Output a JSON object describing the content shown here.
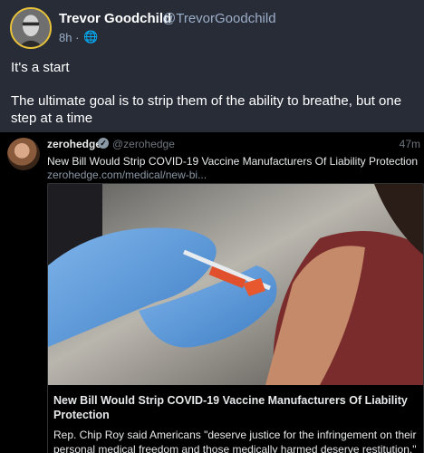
{
  "post": {
    "display_name": "Trevor Goodchild",
    "handle": "@TrevorGoodchild",
    "time": "8h",
    "separator": "·",
    "visibility_icon": "globe-icon",
    "paragraph_1": "It's a start",
    "paragraph_2": "The ultimate goal is to strip them of the ability to breathe, but one step at a time"
  },
  "embedded_tweet": {
    "name": "zerohedge",
    "handle": "@zerohedge",
    "time": "47m",
    "text": "New Bill Would Strip COVID-19 Vaccine Manufacturers Of Liability Protection",
    "link": "zerohedge.com/medical/new-bi...",
    "card": {
      "title": "New Bill Would Strip COVID-19 Vaccine Manufacturers Of Liability Protection",
      "description": "Rep. Chip Roy said Americans \"deserve justice for the infringement on their personal medical freedom and those medically harmed deserve restitution.\""
    }
  },
  "colors": {
    "post_bg": "#282c37",
    "page_bg": "#1f2330",
    "tweet_bg": "#000000",
    "muted": "#9baec8",
    "avatar_ring": "#e8c23a"
  }
}
